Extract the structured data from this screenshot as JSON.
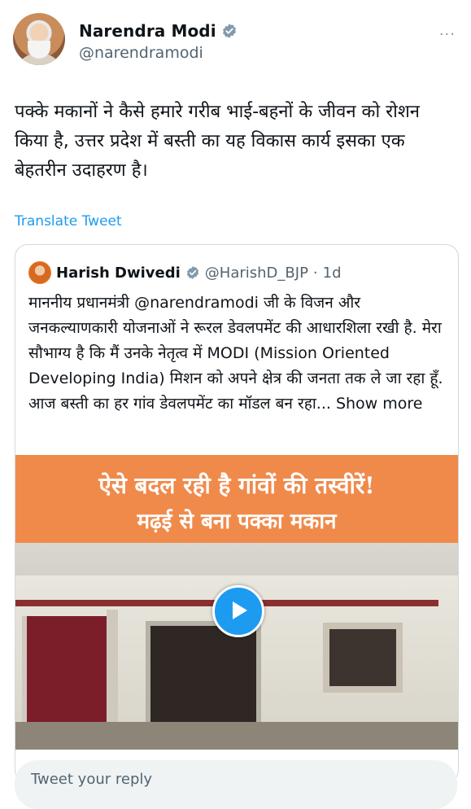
{
  "author": {
    "name": "Narendra Modi",
    "handle": "@narendramodi"
  },
  "tweet": {
    "text": "पक्के मकानों ने कैसे हमारे गरीब भाई-बहनों के जीवन को रोशन किया है, उत्तर प्रदेश में बस्ती का यह विकास कार्य इसका एक बेहतरीन उदाहरण है।",
    "translate_label": "Translate Tweet",
    "more_menu": "···"
  },
  "quoted": {
    "name": "Harish Dwivedi",
    "handle": "@HarishD_BJP",
    "separator": "·",
    "time": "1d",
    "text": "माननीय प्रधानमंत्री @narendramodi जी के विजन और जनकल्याणकारी योजनाओं ने रूरल डेवलपमेंट की आधारशिला रखी है. मेरा सौभाग्य है कि मैं उनके नेतृत्व में MODI (Mission Oriented Developing India) मिशन को अपने क्षेत्र की जनता तक ले जा रहा हूँ. आज बस्ती का हर गांव डेवलपमेंट का मॉडल बन रहा...",
    "show_more": "Show more",
    "media": {
      "banner_line1": "ऐसे बदल रही है गांवों की तस्वीरें!",
      "banner_line2": "मढ़ई से बना पक्का मकान",
      "banner_color": "#f08a4b"
    }
  },
  "reply": {
    "placeholder": "Tweet your reply"
  },
  "colors": {
    "accent": "#1d9bf0",
    "secondary_text": "#536471"
  }
}
